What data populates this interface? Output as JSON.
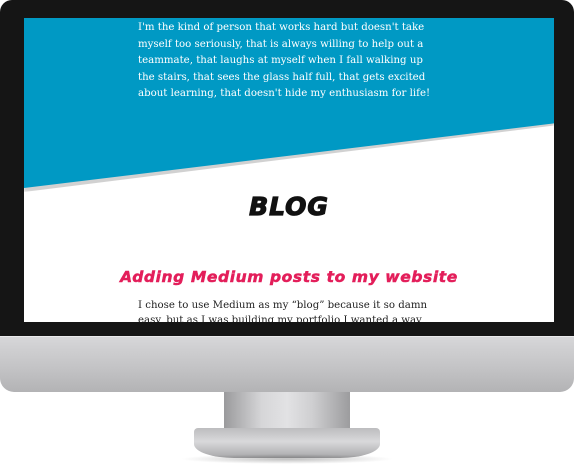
{
  "hero": {
    "intro": "I'm the kind of person that works hard but doesn't take myself too seriously, that is always willing to help out a teammate, that laughs at myself when I fall walking up the stairs, that sees the glass half full, that gets excited about learning, that doesn't hide my enthusiasm for life!"
  },
  "blog": {
    "heading": "BLOG",
    "posts": [
      {
        "title": "Adding Medium posts to my website",
        "excerpt": "I chose to use Medium as my “blog” because it so damn easy, but as I was building my portfolio I wanted a way to…"
      }
    ]
  },
  "colors": {
    "hero_background": "#0099c4",
    "post_title": "#e31e5a",
    "bezel": "#151515"
  }
}
